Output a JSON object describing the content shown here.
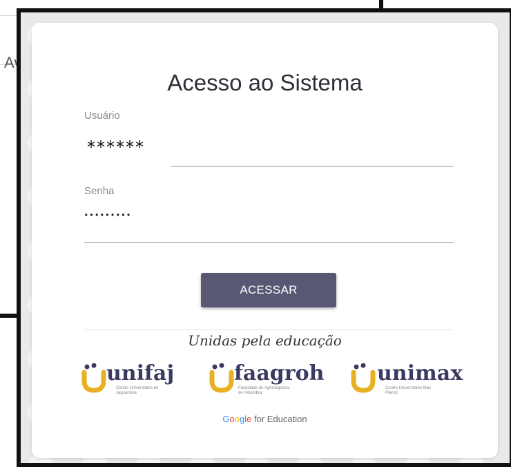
{
  "background": {
    "tab_fragment": "Av"
  },
  "login": {
    "title": "Acesso ao Sistema",
    "username_label": "Usuário",
    "username_value": "******",
    "password_label": "Senha",
    "password_value": "·········",
    "submit_label": "ACESSAR"
  },
  "footer": {
    "tagline": "Unidas pela educação",
    "logos": [
      {
        "name": "unifaj",
        "subtitle": "Centro Universitário de Jaguariúna"
      },
      {
        "name": "faagroh",
        "subtitle": "Faculdade de Agronegócios de Holambra"
      },
      {
        "name": "unimax",
        "subtitle": "Centro Universitário Max Planck"
      }
    ],
    "google_word": "Google",
    "google_suffix": " for Education"
  },
  "colors": {
    "button": "#585874",
    "logo_text": "#3a3a62",
    "logo_mark": "#e8b023"
  }
}
